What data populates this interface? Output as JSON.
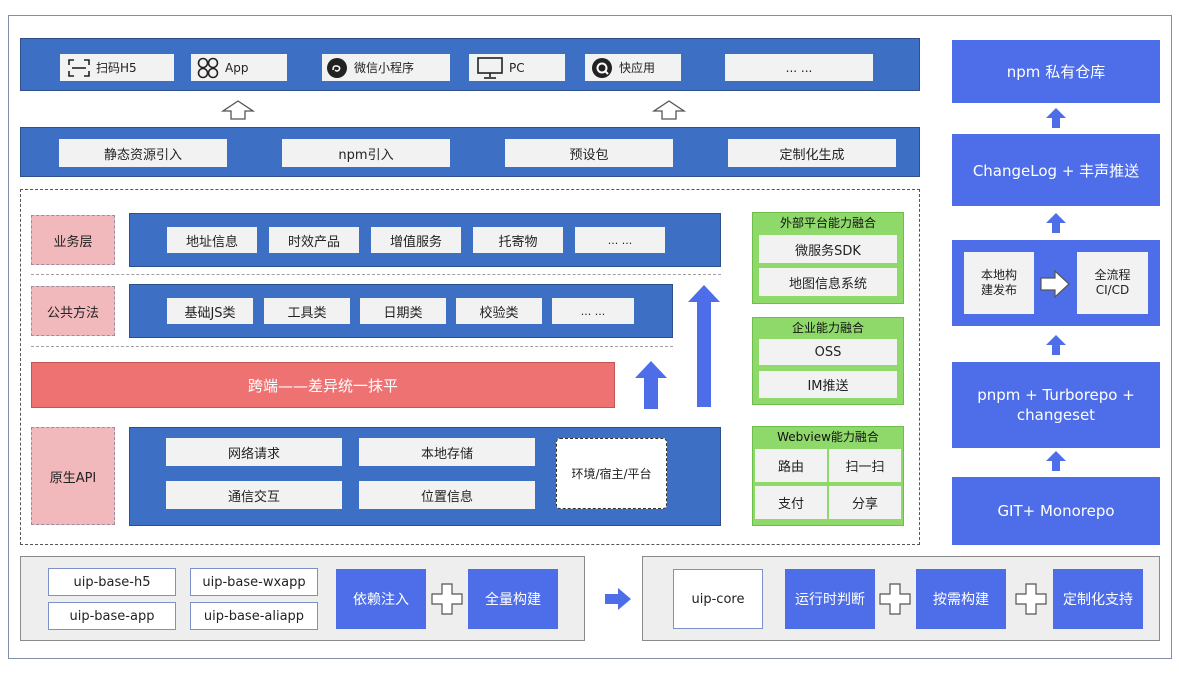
{
  "top_row": {
    "items": [
      {
        "label": "扫码H5",
        "icon": "scan-icon"
      },
      {
        "label": "App",
        "icon": "app-grid-icon"
      },
      {
        "label": "微信小程序",
        "icon": "wechat-miniprogram-icon"
      },
      {
        "label": "PC",
        "icon": "monitor-icon"
      },
      {
        "label": "快应用",
        "icon": "quickapp-icon"
      },
      {
        "label": "... ...",
        "icon": ""
      }
    ]
  },
  "import_row": {
    "items": [
      "静态资源引入",
      "npm引入",
      "预设包",
      "定制化生成"
    ]
  },
  "layers": {
    "business": {
      "label": "业务层",
      "items": [
        "地址信息",
        "时效产品",
        "增值服务",
        "托寄物",
        "... ..."
      ]
    },
    "public": {
      "label": "公共方法",
      "items": [
        "基础JS类",
        "工具类",
        "日期类",
        "校验类",
        "... ..."
      ]
    },
    "cross": {
      "label": "跨端——差异统一抹平"
    },
    "native": {
      "label": "原生API",
      "items": [
        "网络请求",
        "本地存储",
        "通信交互",
        "位置信息"
      ],
      "env": "环境/宿主/平台"
    }
  },
  "capabilities": {
    "external": {
      "title": "外部平台能力融合",
      "items": [
        "微服务SDK",
        "地图信息系统"
      ]
    },
    "enterprise": {
      "title": "企业能力融合",
      "items": [
        "OSS",
        "IM推送"
      ]
    },
    "webview": {
      "title": "Webview能力融合",
      "items": [
        "路由",
        "扫一扫",
        "支付",
        "分享"
      ]
    }
  },
  "pipeline": {
    "npm": "npm 私有仓库",
    "changelog": "ChangeLog + 丰声推送",
    "local_build": "本地构建发布",
    "cicd": "全流程CI/CD",
    "pnpm": "pnpm + Turborepo + changeset",
    "git": "GIT+ Monorepo"
  },
  "bottom": {
    "base_packages": [
      "uip-base-h5",
      "uip-base-wxapp",
      "uip-base-app",
      "uip-base-aliapp"
    ],
    "di": "依赖注入",
    "full_build": "全量构建",
    "core": "uip-core",
    "runtime": "运行时判断",
    "on_demand": "按需构建",
    "custom": "定制化支持"
  },
  "colors": {
    "primary_blue": "#3d6fc4",
    "bright_blue": "#4d6ee8",
    "green": "#8fd86a",
    "pink": "#f2b9bd",
    "red": "#ef7272"
  }
}
